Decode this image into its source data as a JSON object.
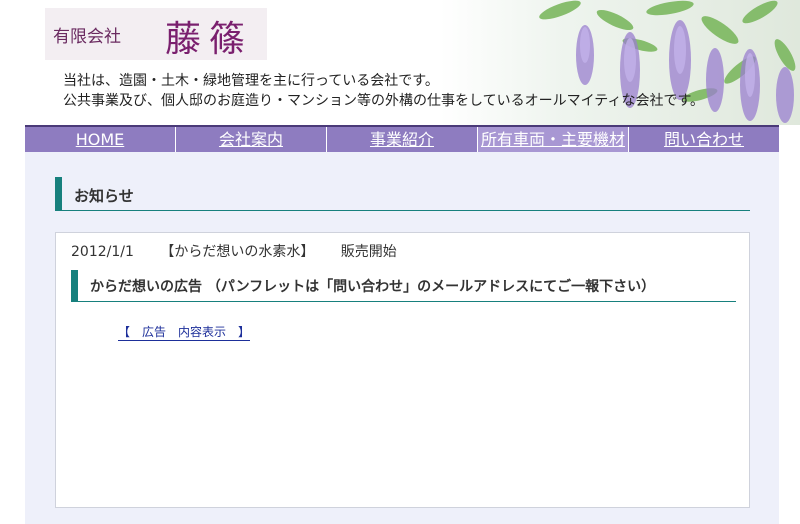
{
  "header": {
    "logo_small": "有限会社",
    "logo_big": "藤篠",
    "tagline_1": "当社は、造園・土木・緑地管理を主に行っている会社です。",
    "tagline_2": "公共事業及び、個人邸のお庭造り・マンション等の外構の仕事をしているオールマイティな会社です。"
  },
  "nav": {
    "items": [
      {
        "label": "HOME"
      },
      {
        "label": "会社案内"
      },
      {
        "label": "事業紹介"
      },
      {
        "label": "所有車両・主要機材"
      },
      {
        "label": "問い合わせ"
      }
    ]
  },
  "main": {
    "section_title": "お知らせ",
    "news": {
      "date": "2012/1/1",
      "product": "【からだ想いの水素水】",
      "status": "販売開始",
      "heading": "からだ想いの広告 （パンフレットは「問い合わせ」のメールアドレスにてご一報下さい）",
      "ad_link": "【　広告　内容表示　】"
    }
  },
  "colors": {
    "nav_bg": "#8e7cc0",
    "accent_teal": "#17807d",
    "content_bg": "#eef0fa",
    "logo_purple": "#7a1f6e"
  }
}
